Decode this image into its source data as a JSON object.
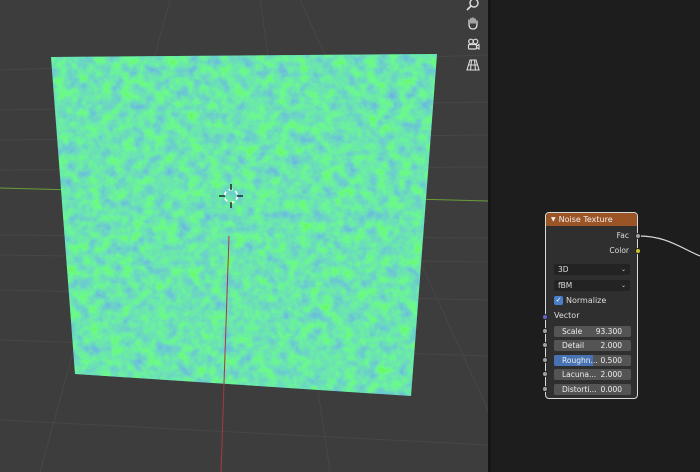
{
  "viewport": {
    "nav_tools": [
      {
        "name": "zoom-icon"
      },
      {
        "name": "pan-hand-icon"
      },
      {
        "name": "camera-icon"
      },
      {
        "name": "grid-icon"
      }
    ]
  },
  "node": {
    "title": "Noise Texture",
    "outputs": [
      {
        "label": "Fac",
        "socket_color": "#a1a1a1"
      },
      {
        "label": "Color",
        "socket_color": "#c7c729"
      }
    ],
    "dimensions_select": "3D",
    "type_select": "fBM",
    "normalize_label": "Normalize",
    "normalize_checked": true,
    "vector_label": "Vector",
    "vector_socket_color": "#6363c7",
    "fields": [
      {
        "label": "Scale",
        "value": "93.300",
        "fill": 0
      },
      {
        "label": "Detail",
        "value": "2.000",
        "fill": 0
      },
      {
        "label": "Roughn...",
        "value": "0.500",
        "fill": 0.5
      },
      {
        "label": "Lacuna...",
        "value": "2.000",
        "fill": 0
      },
      {
        "label": "Distorti...",
        "value": "0.000",
        "fill": 0
      }
    ]
  },
  "colors": {
    "accent": "#4772b3",
    "node_header": "#9b5426"
  }
}
